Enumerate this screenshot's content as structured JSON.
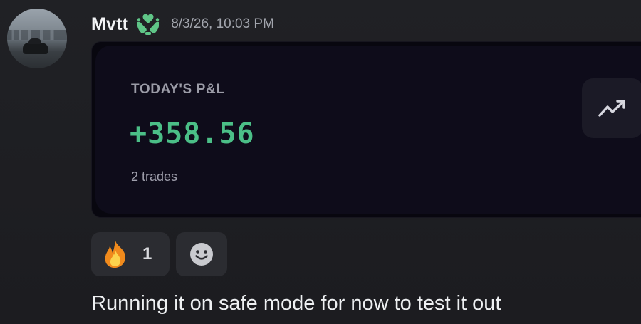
{
  "message": {
    "username": "Mvtt",
    "timestamp": "8/3/26, 10:03 PM",
    "badge_icon": "heart-hands-icon",
    "badge_color": "#5fc587",
    "avatar_icon": "car-photo-avatar",
    "text": "Running it on safe mode for now to test it out"
  },
  "card": {
    "label": "TODAY'S P&L",
    "value": "+358.56",
    "value_color": "#4bbf87",
    "trades": "2 trades",
    "trend_icon": "trending-up-icon"
  },
  "reactions": [
    {
      "emoji_icon": "fire-emoji-icon",
      "count": "1"
    },
    {
      "emoji_icon": "add-reaction-smiley-icon"
    }
  ]
}
